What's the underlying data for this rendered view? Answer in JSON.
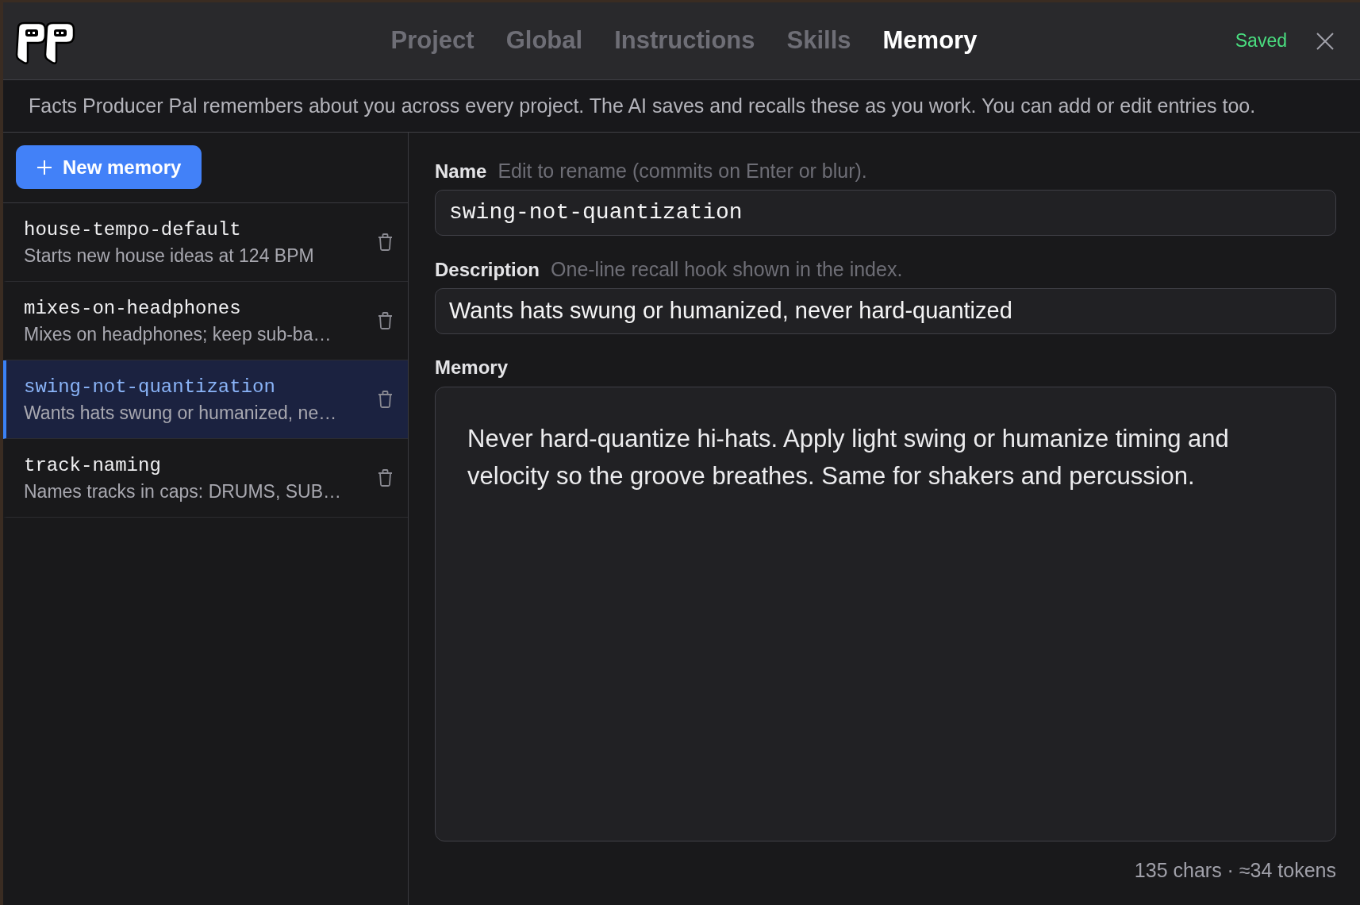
{
  "header": {
    "tabs": [
      {
        "label": "Project",
        "selected": false
      },
      {
        "label": "Global",
        "selected": false
      },
      {
        "label": "Instructions",
        "selected": false
      },
      {
        "label": "Skills",
        "selected": false
      },
      {
        "label": "Memory",
        "selected": true
      }
    ],
    "status": "Saved"
  },
  "intro": "Facts Producer Pal remembers about you across every project. The AI saves and recalls these as you work. You can add or edit entries too.",
  "sidebar": {
    "new_button": "New memory",
    "items": [
      {
        "name": "house-tempo-default",
        "description": "Starts new house ideas at 124 BPM",
        "selected": false
      },
      {
        "name": "mixes-on-headphones",
        "description": "Mixes on headphones; keep sub-ba…",
        "selected": false
      },
      {
        "name": "swing-not-quantization",
        "description": "Wants hats swung or humanized, ne…",
        "selected": true
      },
      {
        "name": "track-naming",
        "description": "Names tracks in caps: DRUMS, SUB…",
        "selected": false
      }
    ]
  },
  "editor": {
    "name_field": {
      "label": "Name",
      "hint": "Edit to rename (commits on Enter or blur).",
      "value": "swing-not-quantization"
    },
    "description_field": {
      "label": "Description",
      "hint": "One-line recall hook shown in the index.",
      "value": "Wants hats swung or humanized, never hard-quantized"
    },
    "memory_field": {
      "label": "Memory",
      "value": "Never hard-quantize hi-hats. Apply light swing or humanize timing and velocity so the groove breathes. Same for shakers and percussion."
    },
    "counter": "135 chars · ≈34 tokens"
  }
}
